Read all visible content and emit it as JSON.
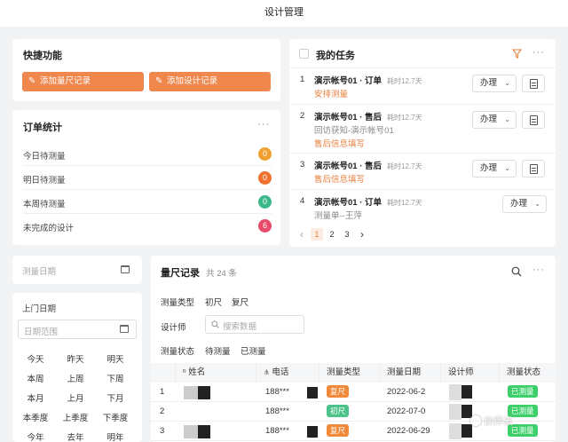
{
  "header": {
    "title": "设计管理"
  },
  "quick": {
    "title": "快捷功能",
    "btn_add_measure": "添加量尺记录",
    "btn_add_design": "添加设计记录"
  },
  "order_stats": {
    "title": "订单统计",
    "more": "···",
    "rows": [
      {
        "label": "今日待测量",
        "count": "0",
        "color": "#f0a030"
      },
      {
        "label": "明日待测量",
        "count": "0",
        "color": "#f07030"
      },
      {
        "label": "本周待测量",
        "count": "0",
        "color": "#3cb88a"
      },
      {
        "label": "未完成的设计",
        "count": "6",
        "color": "#e84a6a"
      }
    ]
  },
  "tasks": {
    "title": "我的任务",
    "more": "···",
    "items": [
      {
        "num": "1",
        "title": "演示帐号01 · 订单",
        "dur": "耗时12.7天",
        "lines": [
          {
            "text": "安排测量",
            "style": "orange"
          }
        ],
        "handle": "办理"
      },
      {
        "num": "2",
        "title": "演示帐号01 · 售后",
        "dur": "耗时12.7天",
        "lines": [
          {
            "text": "回访获知-演示帐号01",
            "style": "gray"
          },
          {
            "text": "售后信息填写",
            "style": "orange"
          }
        ],
        "handle": "办理"
      },
      {
        "num": "3",
        "title": "演示帐号01 · 售后",
        "dur": "耗时12.7天",
        "lines": [
          {
            "text": "售后信息填写",
            "style": "orange"
          }
        ],
        "handle": "办理"
      },
      {
        "num": "4",
        "title": "演示帐号01 · 订单",
        "dur": "耗时12.7天",
        "lines": [
          {
            "text": "测量单--王萍",
            "style": "gray"
          }
        ],
        "handle": "办理"
      }
    ],
    "pages": [
      "1",
      "2",
      "3"
    ],
    "prev": "‹",
    "next": "›"
  },
  "measure_date": {
    "placeholder": "测量日期"
  },
  "visit": {
    "title": "上门日期",
    "range_placeholder": "日期范围",
    "shortcuts": [
      [
        "今天",
        "昨天",
        "明天"
      ],
      [
        "本周",
        "上周",
        "下周"
      ],
      [
        "本月",
        "上月",
        "下月"
      ],
      [
        "本季度",
        "上季度",
        "下季度"
      ],
      [
        "今年",
        "去年",
        "明年"
      ]
    ]
  },
  "records": {
    "title": "量尺记录",
    "count": "共 24 条",
    "more": "···",
    "filter_type_label": "测量类型",
    "filter_type_opts": [
      "初尺",
      "复尺"
    ],
    "filter_designer_label": "设计师",
    "search_placeholder": "搜索数据",
    "filter_status_label": "测量状态",
    "filter_status_opts": [
      "待测量",
      "已测量"
    ],
    "columns": [
      "",
      "姓名",
      "电话",
      "测量类型",
      "测量日期",
      "设计师",
      "测量状态"
    ],
    "rows": [
      {
        "no": "1",
        "phone": "188***",
        "type": "复尺",
        "type_color": "#f08a3a",
        "date": "2022-06-2",
        "status": "已测量"
      },
      {
        "no": "2",
        "phone": "188***",
        "type": "初尺",
        "type_color": "#4cc38a",
        "date": "2022-07-0",
        "status": "已测量"
      },
      {
        "no": "3",
        "phone": "188***",
        "type": "复尺",
        "type_color": "#f08a3a",
        "date": "2022-06-29",
        "status": "已测量"
      }
    ],
    "status_color": "#3ccf6a"
  },
  "watermark": "伙伴云"
}
